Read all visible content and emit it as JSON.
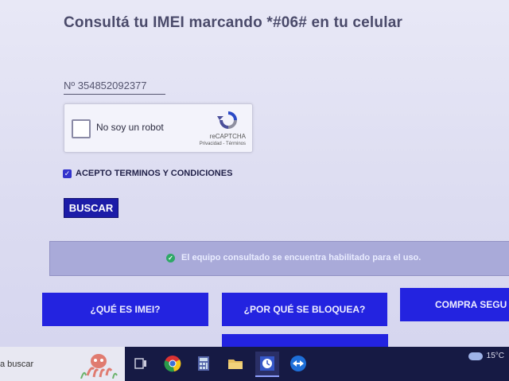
{
  "page": {
    "title": "Consultá tu IMEI marcando *#06# en tu celular",
    "imei_value": "Nº 354852092377",
    "captcha": {
      "label": "No soy un robot",
      "brand": "reCAPTCHA",
      "links": "Privacidad - Términos"
    },
    "terms_label": "ACEPTO TERMINOS Y CONDICIONES",
    "terms_checked": true,
    "search_button": "BUSCAR",
    "result_message": "El equipo consultado se encuentra habilitado para el uso.",
    "nav_buttons": [
      "¿QUÉ ES IMEI?",
      "¿POR QUÉ SE BLOQUEA?",
      "COMPRA SEGU"
    ]
  },
  "taskbar": {
    "search_text": "a buscar",
    "apps": [
      "task-view-icon",
      "chrome-icon",
      "calculator-icon",
      "file-explorer-icon",
      "clock-app-icon",
      "teamviewer-icon"
    ],
    "temperature": "15°C"
  },
  "colors": {
    "primary_button": "#1c1ca8",
    "nav_button": "#2323e0",
    "alert_bg": "#a9aad9",
    "success": "#2ea866"
  }
}
